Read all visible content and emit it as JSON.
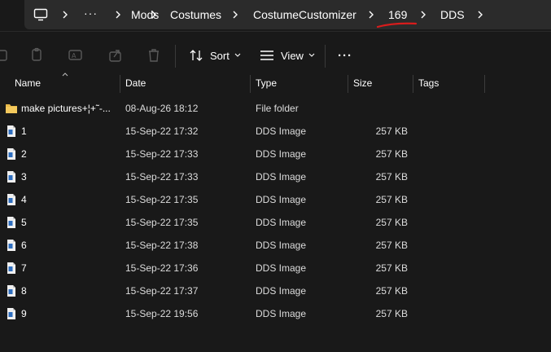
{
  "breadcrumb": {
    "items": [
      "Mods",
      "Costumes",
      "CostumeCustomizer",
      "169",
      "DDS"
    ],
    "overflow": "···"
  },
  "toolbar": {
    "sort_label": "Sort",
    "view_label": "View",
    "more_label": "···"
  },
  "columns": [
    "Name",
    "Date",
    "Type",
    "Size",
    "Tags"
  ],
  "files": [
    {
      "name": "make pictures+¦+˜-...",
      "date": "08-Aug-26 18:12",
      "type": "File folder",
      "size": "",
      "kind": "folder"
    },
    {
      "name": "1",
      "date": "15-Sep-22 17:32",
      "type": "DDS Image",
      "size": "257 KB",
      "kind": "file"
    },
    {
      "name": "2",
      "date": "15-Sep-22 17:33",
      "type": "DDS Image",
      "size": "257 KB",
      "kind": "file"
    },
    {
      "name": "3",
      "date": "15-Sep-22 17:33",
      "type": "DDS Image",
      "size": "257 KB",
      "kind": "file"
    },
    {
      "name": "4",
      "date": "15-Sep-22 17:35",
      "type": "DDS Image",
      "size": "257 KB",
      "kind": "file"
    },
    {
      "name": "5",
      "date": "15-Sep-22 17:35",
      "type": "DDS Image",
      "size": "257 KB",
      "kind": "file"
    },
    {
      "name": "6",
      "date": "15-Sep-22 17:38",
      "type": "DDS Image",
      "size": "257 KB",
      "kind": "file"
    },
    {
      "name": "7",
      "date": "15-Sep-22 17:36",
      "type": "DDS Image",
      "size": "257 KB",
      "kind": "file"
    },
    {
      "name": "8",
      "date": "15-Sep-22 17:37",
      "type": "DDS Image",
      "size": "257 KB",
      "kind": "file"
    },
    {
      "name": "9",
      "date": "15-Sep-22 19:56",
      "type": "DDS Image",
      "size": "257 KB",
      "kind": "file"
    }
  ],
  "colors": {
    "background": "#191919",
    "address_bar": "#2b2b2b",
    "folder": "#e8b94a",
    "file_icon": "#4a8fd8",
    "annotation": "#d91c1c"
  }
}
